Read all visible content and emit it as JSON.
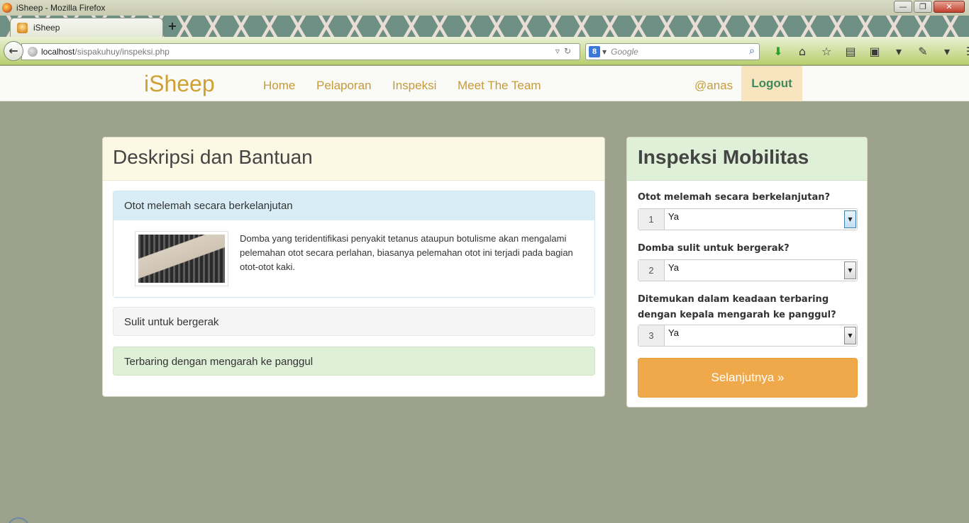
{
  "browser": {
    "window_title": "iSheep - Mozilla Firefox",
    "tab_title": "iSheep",
    "url_host": "localhost",
    "url_path": "/sispakuhuy/inspeksi.php",
    "search_placeholder": "Google",
    "new_tab": "+",
    "win_min": "—",
    "win_max": "❐",
    "win_close": "✕",
    "back": "←"
  },
  "header": {
    "brand": "iSheep",
    "nav": [
      "Home",
      "Pelaporan",
      "Inspeksi",
      "Meet The Team"
    ],
    "user": "@anas",
    "logout": "Logout"
  },
  "left_panel": {
    "title": "Deskripsi dan Bantuan",
    "items": [
      {
        "heading": "Otot melemah secara berkelanjutan",
        "body": "Domba yang teridentifikasi penyakit tetanus ataupun botulisme akan mengalami pelemahan otot secara perlahan, biasanya pelemahan otot ini terjadi pada bagian otot-otot kaki."
      },
      {
        "heading": "Sulit untuk bergerak"
      },
      {
        "heading": "Terbaring dengan mengarah ke panggul"
      }
    ]
  },
  "right_panel": {
    "title": "Inspeksi Mobilitas",
    "questions": [
      {
        "label": "Otot melemah secara berkelanjutan?",
        "number": "1",
        "value": "Ya"
      },
      {
        "label": "Domba sulit untuk bergerak?",
        "number": "2",
        "value": "Ya"
      },
      {
        "label": "Ditemukan dalam keadaan terbaring dengan kepala mengarah ke panggul?",
        "number": "3",
        "value": "Ya"
      }
    ],
    "next_button": "Selanjutnya »"
  }
}
